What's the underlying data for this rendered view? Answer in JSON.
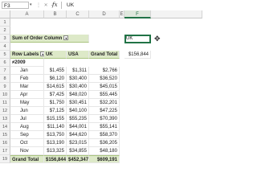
{
  "formula_bar": {
    "name_box": "F3",
    "fx": "fx",
    "value": "UK"
  },
  "columns": [
    "A",
    "B",
    "C",
    "D",
    "E",
    "F"
  ],
  "selected_column": "F",
  "pivot": {
    "header_label": "Sum of Order",
    "header_label2": "Column",
    "row_labels": "Row Labels",
    "col_uk": "UK",
    "col_usa": "USA",
    "col_total": "Grand Total",
    "year": "≠2009",
    "months": [
      {
        "row": "7",
        "m": "Jan",
        "uk": "$1,455",
        "usa": "$1,311",
        "t": "$2,766"
      },
      {
        "row": "8",
        "m": "Feb",
        "uk": "$6,120",
        "usa": "$30,400",
        "t": "$36,520"
      },
      {
        "row": "9",
        "m": "Mar",
        "uk": "$14,615",
        "usa": "$30,400",
        "t": "$45,015"
      },
      {
        "row": "10",
        "m": "Apr",
        "uk": "$7,425",
        "usa": "$48,020",
        "t": "$55,445"
      },
      {
        "row": "11",
        "m": "May",
        "uk": "$1,750",
        "usa": "$30,451",
        "t": "$32,201"
      },
      {
        "row": "12",
        "m": "Jun",
        "uk": "$7,125",
        "usa": "$40,100",
        "t": "$47,225"
      },
      {
        "row": "13",
        "m": "Jul",
        "uk": "$15,155",
        "usa": "$55,235",
        "t": "$70,390"
      },
      {
        "row": "14",
        "m": "Aug",
        "uk": "$11,140",
        "usa": "$44,001",
        "t": "$55,141"
      },
      {
        "row": "15",
        "m": "Sep",
        "uk": "$13,750",
        "usa": "$44,620",
        "t": "$58,370"
      },
      {
        "row": "16",
        "m": "Oct",
        "uk": "$13,190",
        "usa": "$23,015",
        "t": "$36,205"
      },
      {
        "row": "17",
        "m": "Nov",
        "uk": "$13,325",
        "usa": "$34,855",
        "t": "$48,180"
      },
      {
        "row": "18",
        "m": "Dec",
        "uk": "$6,835",
        "usa": "$15,145",
        "t": "$21,980"
      }
    ],
    "grand_total": {
      "row": "19",
      "label": "Grand Total",
      "uk": "$156,844",
      "usa": "$452,347",
      "t": "$609,191"
    }
  },
  "cells": {
    "F3": "UK",
    "F5": "$156,844"
  },
  "row_numbers": [
    "1",
    "2",
    "3",
    "4",
    "5",
    "6"
  ]
}
